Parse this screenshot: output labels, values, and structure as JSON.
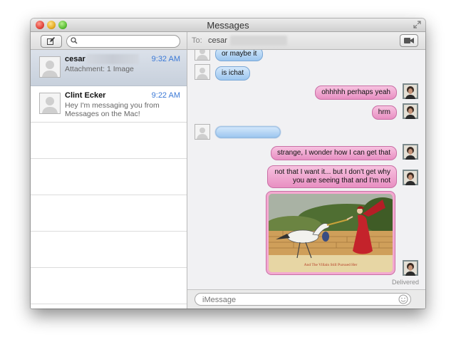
{
  "window": {
    "title": "Messages"
  },
  "search": {
    "placeholder": ""
  },
  "conversations": [
    {
      "name": "cesar",
      "time": "9:32 AM",
      "preview": "Attachment: 1 Image",
      "selected": true
    },
    {
      "name": "Clint Ecker",
      "time": "9:22 AM",
      "preview": "Hey I'm messaging you from Messages on the Mac!",
      "selected": false
    }
  ],
  "chat": {
    "to_label": "To:",
    "recipient": "cesar",
    "messages": [
      {
        "side": "received",
        "text": "or maybe it"
      },
      {
        "side": "received",
        "text": "is ichat"
      },
      {
        "side": "sent",
        "text": "ohhhhh perhaps yeah"
      },
      {
        "side": "sent",
        "text": "hrm"
      },
      {
        "side": "received",
        "text": ""
      },
      {
        "side": "sent",
        "text": "strange, I wonder how I can get that"
      },
      {
        "side": "sent",
        "text": "not that I want it... but I don't get why you are seeing that and I'm not"
      },
      {
        "side": "sent",
        "attachment": "image",
        "caption": "And The Villain Still Pursued Her"
      }
    ],
    "status": "Delivered",
    "input_placeholder": "iMessage"
  },
  "colors": {
    "sent_bubble": "#e88fc2",
    "received_bubble": "#9cc6ef",
    "time_text": "#3b79d6"
  }
}
